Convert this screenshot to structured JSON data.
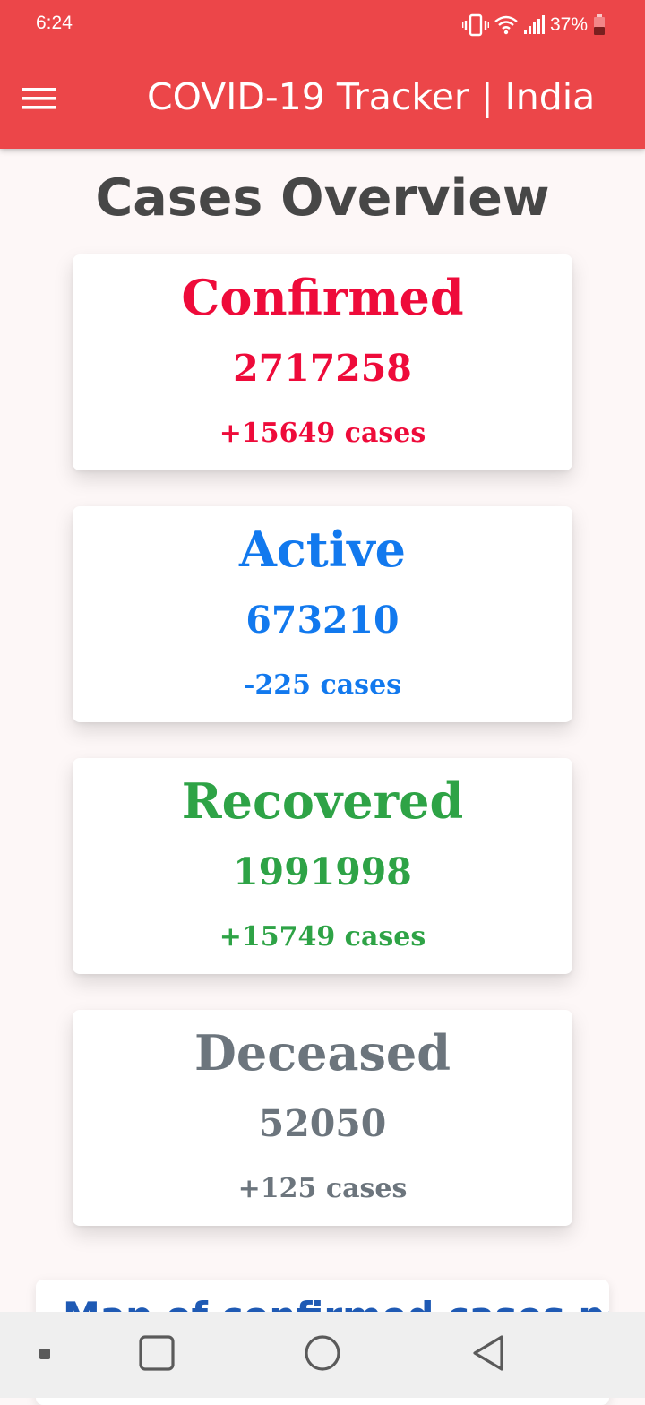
{
  "status_bar": {
    "time": "6:24",
    "battery_percent": "37%",
    "icons": [
      "vibrate-icon",
      "wifi-icon",
      "signal-icon",
      "battery-icon"
    ]
  },
  "app_bar": {
    "title": "COVID-19 Tracker | India",
    "menu_icon": "hamburger-menu-icon",
    "background_color": "#ec4649"
  },
  "page": {
    "title": "Cases Overview"
  },
  "cards": [
    {
      "label": "Confirmed",
      "value": "2717258",
      "delta": "+15649 cases",
      "color": "#ee0b3a"
    },
    {
      "label": "Active",
      "value": "673210",
      "delta": "-225 cases",
      "color": "#1279ee"
    },
    {
      "label": "Recovered",
      "value": "1991998",
      "delta": "+15749 cases",
      "color": "#2ea346"
    },
    {
      "label": "Deceased",
      "value": "52050",
      "delta": "+125 cases",
      "color": "#6c757d"
    }
  ],
  "map_section": {
    "title": "Map of confirmed cases per"
  },
  "nav_bar": {
    "buttons": [
      "menu-icon",
      "recents-icon",
      "home-icon",
      "back-icon"
    ]
  }
}
